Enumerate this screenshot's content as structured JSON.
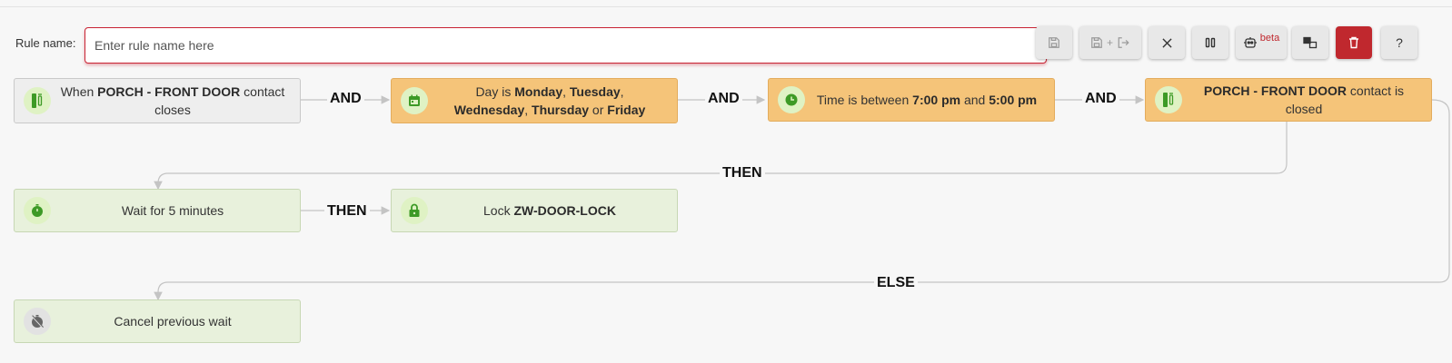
{
  "toolbar": {
    "rule_name_label": "Rule name:",
    "rule_name_placeholder": "Enter rule name here",
    "rule_name_value": "",
    "buttons": {
      "save_icon": "save-icon",
      "save_exit_icons": [
        "save-icon",
        "exit-icon"
      ],
      "save_exit_plus": "+",
      "close_icon": "close-icon",
      "pause_icon": "pause-icon",
      "ai_icon": "robot-icon",
      "ai_beta": "beta",
      "copy_icon": "copy-icon",
      "delete_icon": "trash-icon",
      "help_label": "?"
    },
    "colors": {
      "danger": "#c0282e",
      "input_border": "#c82333"
    }
  },
  "flow": {
    "triggers": [
      {
        "icon": "contact-sensor-icon",
        "parts": [
          {
            "t": "When ",
            "b": false
          },
          {
            "t": "PORCH - FRONT DOOR",
            "b": true
          },
          {
            "t": " contact closes",
            "b": false
          }
        ]
      },
      {
        "icon": "calendar-icon",
        "parts": [
          {
            "t": "Day is ",
            "b": false
          },
          {
            "t": "Monday",
            "b": true
          },
          {
            "t": ", ",
            "b": false
          },
          {
            "t": "Tuesday",
            "b": true
          },
          {
            "t": ", ",
            "b": false
          },
          {
            "t": "Wednesday",
            "b": true
          },
          {
            "t": ", ",
            "b": false
          },
          {
            "t": "Thursday",
            "b": true
          },
          {
            "t": " or ",
            "b": false
          },
          {
            "t": "Friday",
            "b": true
          }
        ]
      },
      {
        "icon": "clock-icon",
        "parts": [
          {
            "t": "Time is between ",
            "b": false
          },
          {
            "t": "7:00 pm",
            "b": true
          },
          {
            "t": " and ",
            "b": false
          },
          {
            "t": "5:00 pm",
            "b": true
          }
        ]
      },
      {
        "icon": "contact-sensor-icon",
        "parts": [
          {
            "t": "PORCH - FRONT DOOR",
            "b": true
          },
          {
            "t": " contact is closed",
            "b": false
          }
        ]
      }
    ],
    "and_label": "AND",
    "then_label": "THEN",
    "else_label": "ELSE",
    "then_actions": [
      {
        "icon": "timer-icon",
        "parts": [
          {
            "t": "Wait for 5 minutes",
            "b": false
          }
        ]
      },
      {
        "icon": "lock-icon",
        "parts": [
          {
            "t": "Lock ",
            "b": false
          },
          {
            "t": "ZW-DOOR-LOCK",
            "b": true
          }
        ]
      }
    ],
    "else_actions": [
      {
        "icon": "timer-off-icon",
        "parts": [
          {
            "t": "Cancel previous wait",
            "b": false
          }
        ]
      }
    ],
    "colors": {
      "trigger_bg": "#eeeeee",
      "condition_bg": "#f5c479",
      "action_bg": "#e8f1dc",
      "icon_green": "#3d9a26"
    }
  }
}
